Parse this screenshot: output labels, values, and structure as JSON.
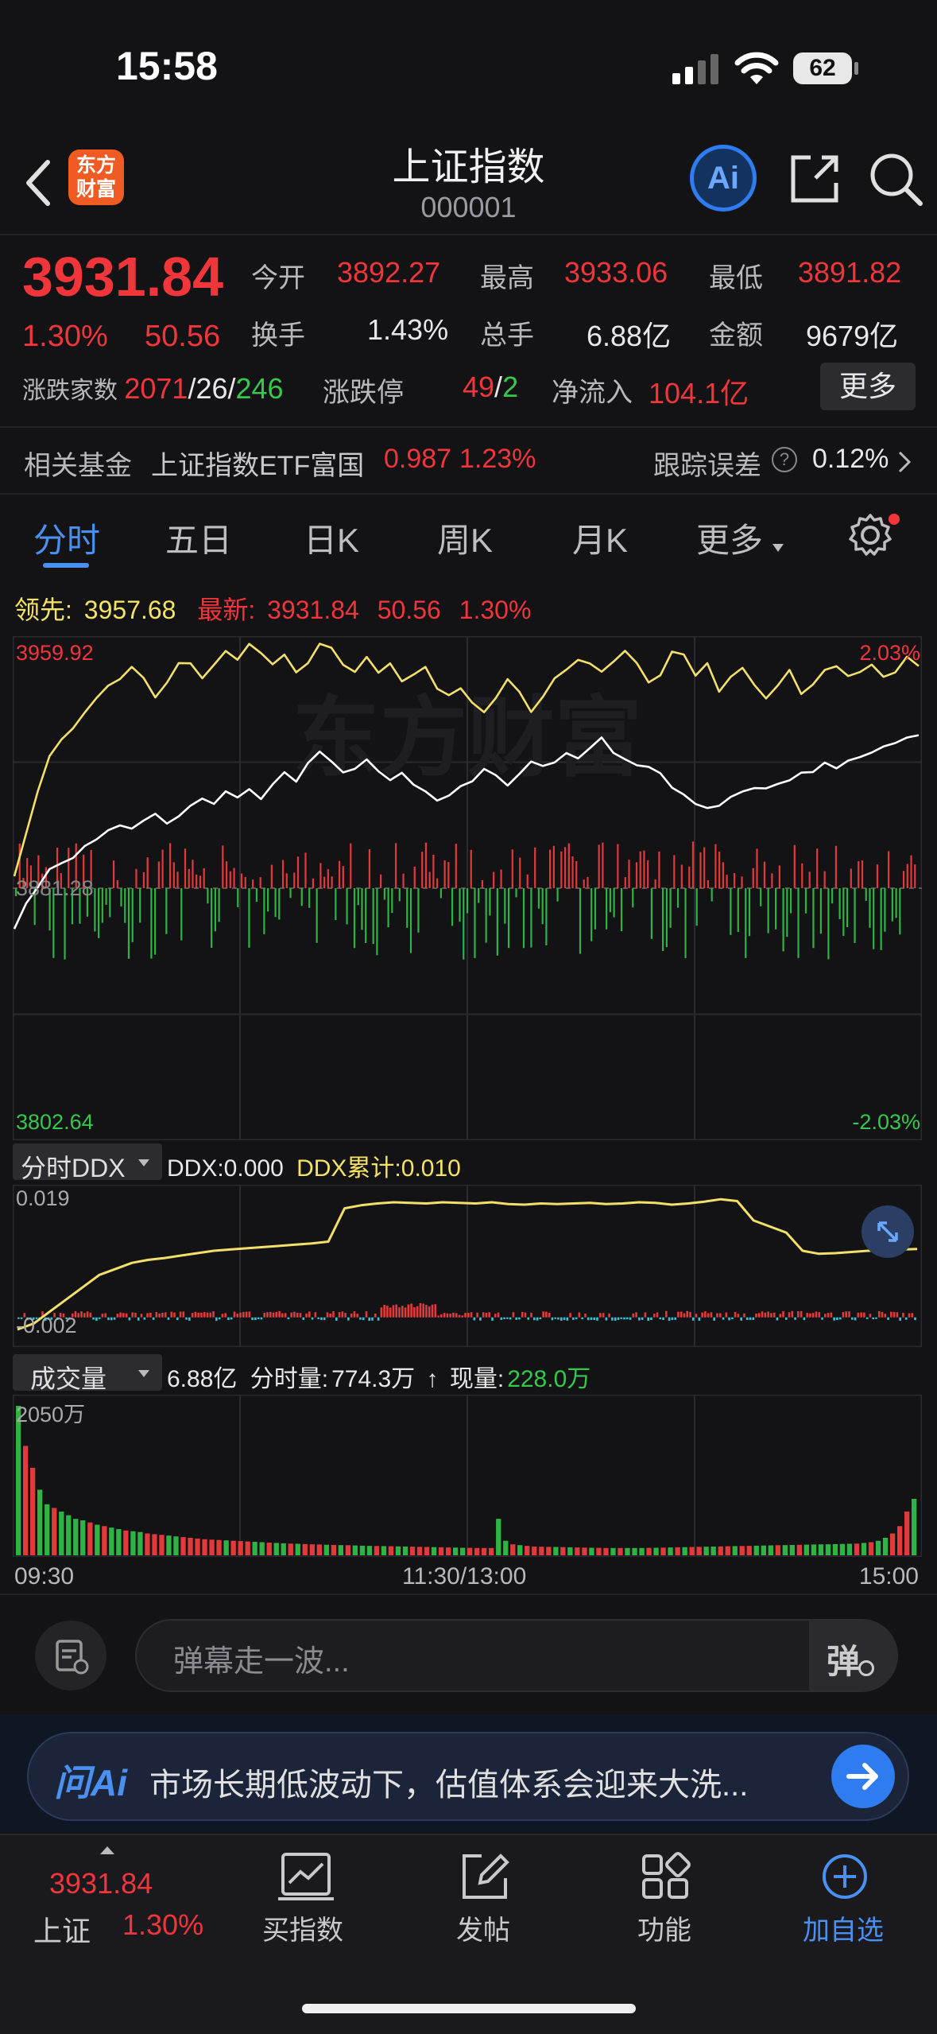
{
  "status_bar": {
    "time": "15:58",
    "battery": "62"
  },
  "header": {
    "logo_line1": "东方",
    "logo_line2": "财富",
    "title": "上证指数",
    "code": "000001",
    "ai_label": "Ai"
  },
  "quote": {
    "price": "3931.84",
    "change_pct": "1.30%",
    "change_abs": "50.56",
    "open_label": "今开",
    "open": "3892.27",
    "high_label": "最高",
    "high": "3933.06",
    "low_label": "最低",
    "low": "3891.82",
    "turnover_label": "换手",
    "turnover": "1.43%",
    "volume_label": "总手",
    "volume": "6.88亿",
    "amount_label": "金额",
    "amount": "9679亿",
    "breadth_label": "涨跌家数",
    "breadth_up": "2071",
    "breadth_sep1": "/",
    "breadth_flat": "26",
    "breadth_sep2": "/",
    "breadth_down": "246",
    "limit_label": "涨跌停",
    "limit_up": "49",
    "limit_sep": "/",
    "limit_down": "2",
    "inflow_label": "净流入",
    "inflow": "104.1亿",
    "more_label": "更多"
  },
  "fund": {
    "label": "相关基金",
    "name": "上证指数ETF富国",
    "price": "0.987",
    "pct": "1.23%",
    "tracking_label": "跟踪误差",
    "tracking_value": "0.12%"
  },
  "tabs": [
    "分时",
    "五日",
    "日K",
    "周K",
    "月K",
    "更多"
  ],
  "chart_info": {
    "lead_label": "领先:",
    "lead_value": "3957.68",
    "latest_label": "最新:",
    "latest_value": "3931.84",
    "latest_change": "50.56",
    "latest_pct": "1.30%"
  },
  "ddx": {
    "selector": "分时DDX",
    "ddx_label": "DDX:0.000",
    "ddx_cum_label": "DDX累计:0.010",
    "top_label": "0.019",
    "bottom_label": "-0.002"
  },
  "volume_panel": {
    "selector": "成交量",
    "total": "6.88亿",
    "min_vol_label": "分时量:",
    "min_vol": "774.3万",
    "arrow": "↑",
    "cur_label": "现量:",
    "cur_vol": "228.0万",
    "max_label": "2050万",
    "time_start": "09:30",
    "time_mid": "11:30/13:00",
    "time_end": "15:00"
  },
  "danmaku": {
    "placeholder": "弹幕走一波...",
    "toggle_label": "弹"
  },
  "ai_banner": {
    "brand": "问Ai",
    "text": "市场长期低波动下，估值体系会迎来大洗..."
  },
  "bottom_nav": {
    "index_price": "3931.84",
    "index_name": "上证",
    "index_pct": "1.30%",
    "items": [
      "买指数",
      "发帖",
      "功能",
      "加自选"
    ]
  },
  "chart_data": [
    {
      "type": "line",
      "title": "",
      "x_labels": [
        "09:30",
        "11:30/13:00",
        "15:00"
      ],
      "ylim": [
        3802.64,
        3959.92
      ],
      "y_labels": [
        "3959.92",
        "3881.28",
        "3802.64"
      ],
      "y_right_labels": [
        "2.03%",
        "-2.03%"
      ],
      "reference": 3881.28,
      "series": [
        {
          "color": "#f3e06a",
          "values": [
            3885,
            3898,
            3912,
            3922,
            3928,
            3931,
            3936,
            3941,
            3944,
            3947,
            3950,
            3947,
            3941,
            3945,
            3952,
            3951,
            3947,
            3951,
            3955,
            3953,
            3957,
            3955,
            3951,
            3954,
            3949,
            3951,
            3958,
            3956,
            3951,
            3949,
            3953,
            3949,
            3951,
            3946,
            3948,
            3950,
            3944,
            3941,
            3944,
            3939,
            3936,
            3941,
            3946,
            3943,
            3936,
            3941,
            3947,
            3949,
            3953,
            3951,
            3949,
            3952,
            3955,
            3952,
            3945,
            3948,
            3955,
            3954,
            3948,
            3951,
            3943,
            3947,
            3950,
            3945,
            3940,
            3945,
            3949,
            3942,
            3945,
            3949,
            3951,
            3947,
            3949,
            3951,
            3947,
            3949,
            3953,
            3951
          ],
          "note_points": 78
        },
        {
          "color": "#ffffff",
          "values": [
            3869,
            3876,
            3882,
            3887,
            3889,
            3891,
            3894,
            3897,
            3899,
            3901,
            3900,
            3902,
            3905,
            3901,
            3904,
            3907,
            3909,
            3908,
            3911,
            3910,
            3912,
            3909,
            3914,
            3917,
            3915,
            3920,
            3924,
            3921,
            3917,
            3919,
            3921,
            3918,
            3915,
            3917,
            3914,
            3911,
            3909,
            3910,
            3913,
            3915,
            3918,
            3917,
            3913,
            3917,
            3921,
            3919,
            3921,
            3923,
            3922,
            3925,
            3928,
            3924,
            3921,
            3920,
            3919,
            3917,
            3913,
            3910,
            3908,
            3906,
            3907,
            3910,
            3911,
            3913,
            3912,
            3914,
            3915,
            3917,
            3918,
            3920,
            3919,
            3921,
            3922,
            3924,
            3925,
            3927,
            3928,
            3929
          ]
        }
      ]
    },
    {
      "type": "line",
      "title": "",
      "ylim": [
        -0.002,
        0.019
      ],
      "series": [
        {
          "color": "#f3e06a",
          "values": [
            -0.002,
            -0.001,
            0.001,
            0.003,
            0.005,
            0.007,
            0.008,
            0.009,
            0.0095,
            0.0098,
            0.0102,
            0.0106,
            0.011,
            0.0112,
            0.0114,
            0.0116,
            0.0118,
            0.012,
            0.0122,
            0.0125,
            0.018,
            0.0185,
            0.0188,
            0.019,
            0.0189,
            0.0188,
            0.019,
            0.0189,
            0.0188,
            0.019,
            0.0187,
            0.0186,
            0.0188,
            0.0187,
            0.0188,
            0.0189,
            0.0187,
            0.0188,
            0.019,
            0.0189,
            0.0186,
            0.0188,
            0.0191,
            0.0195,
            0.0192,
            0.016,
            0.015,
            0.014,
            0.011,
            0.0105,
            0.0106,
            0.0108,
            0.011,
            0.0111,
            0.0112,
            0.0113
          ]
        }
      ]
    },
    {
      "type": "bar",
      "title": "",
      "ylim": [
        0,
        2050
      ],
      "y_labels": [
        "2050万"
      ],
      "values": [
        2050,
        1500,
        1200,
        900,
        700,
        650,
        600,
        550,
        500,
        480,
        450,
        420,
        400,
        380,
        360,
        340,
        330,
        320,
        300,
        290,
        280,
        270,
        260,
        250,
        240,
        230,
        220,
        215,
        210,
        205,
        200,
        195,
        190,
        185,
        180,
        175,
        170,
        165,
        160,
        158,
        155,
        150,
        148,
        145,
        142,
        140,
        138,
        135,
        132,
        130,
        128,
        126,
        124,
        122,
        120,
        118,
        116,
        114,
        112,
        110,
        108,
        106,
        104,
        102,
        100,
        100,
        100,
        500,
        200,
        150,
        140,
        130,
        120,
        118,
        116,
        114,
        112,
        110,
        108,
        106,
        104,
        102,
        100,
        100,
        100,
        100,
        100,
        100,
        102,
        104,
        106,
        108,
        110,
        112,
        114,
        116,
        118,
        120,
        122,
        124,
        126,
        128,
        130,
        132,
        134,
        136,
        138,
        140,
        142,
        144,
        146,
        148,
        150,
        152,
        154,
        156,
        158,
        160,
        170,
        180,
        200,
        240,
        300,
        400,
        600,
        774
      ]
    }
  ]
}
